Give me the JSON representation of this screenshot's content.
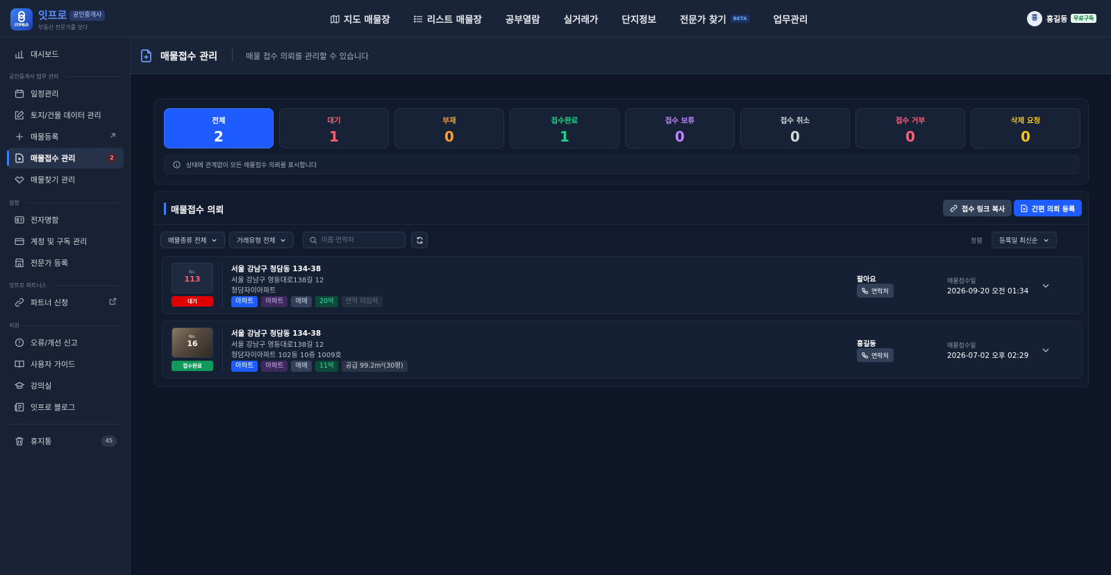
{
  "brand": {
    "name": "잇프로",
    "badge": "공인중개사",
    "tagline": "부동산 전문가를 잇다",
    "logo_text": "ITPRO"
  },
  "nav": [
    {
      "label": "지도 매물장",
      "icon": "map-icon"
    },
    {
      "label": "리스트 매물장",
      "icon": "list-icon"
    },
    {
      "label": "공부열람"
    },
    {
      "label": "실거래가"
    },
    {
      "label": "단지정보"
    },
    {
      "label": "전문가 찾기",
      "badge": "BETA"
    },
    {
      "label": "업무관리"
    }
  ],
  "user": {
    "avatar": "홍",
    "name": "홍길동",
    "plan": "무료구독"
  },
  "sidebar": {
    "dashboard": "대시보드",
    "section_work": "공인중개사 업무 관리",
    "schedule": "일정관리",
    "land_data": "토지/건물 데이터 관리",
    "register": "매물등록",
    "intake": "매물접수 관리",
    "intake_count": "2",
    "find": "매물찾기 관리",
    "section_settings": "설정",
    "ecard": "전자명함",
    "account": "계정 및 구독 관리",
    "expert": "전문가 등록",
    "section_partners": "잇프로 파트너스",
    "partner": "파트너 신청",
    "section_support": "지원",
    "report": "오류/개선 신고",
    "guide": "사용자 가이드",
    "lecture": "강의실",
    "blog": "잇프로 블로그",
    "trash": "휴지통",
    "trash_count": "45"
  },
  "page": {
    "title": "매물접수 관리",
    "description": "매물 접수 의뢰를 관리할 수 있습니다"
  },
  "stats": [
    {
      "label": "전체",
      "value": "2",
      "color": "#ffffff"
    },
    {
      "label": "대기",
      "value": "1",
      "color": "#ff5f6d"
    },
    {
      "label": "부재",
      "value": "0",
      "color": "#ff9f2e"
    },
    {
      "label": "접수완료",
      "value": "1",
      "color": "#19d58a"
    },
    {
      "label": "접수 보류",
      "value": "0",
      "color": "#c084fc"
    },
    {
      "label": "접수 취소",
      "value": "0",
      "color": "#d1d5db"
    },
    {
      "label": "접수 거부",
      "value": "0",
      "color": "#ff5f7e"
    },
    {
      "label": "삭제 요청",
      "value": "0",
      "color": "#f5c518"
    }
  ],
  "stats_note": "상태에 관계없이 모든 매물접수 의뢰를 표시합니다",
  "list": {
    "title": "매물접수 의뢰",
    "copy_link": "접수 링크 복사",
    "quick_register": "간편 의뢰 등록",
    "filter_type": "매물종류 전체",
    "filter_deal": "거래유형 전체",
    "search_placeholder": "이름·연락처",
    "sort_label": "정렬",
    "sort_value": "등록일 최신순"
  },
  "rows": [
    {
      "no_label": "No.",
      "no": "113",
      "no_color": "#ff5f6d",
      "status": "대기",
      "status_color": "#e00000",
      "addr1": "서울 강남구 청담동 134-38",
      "addr2": "서울 강남구 영동대로138길 12",
      "addr3": "청담자이아파트",
      "chips": [
        {
          "text": "아파트",
          "bg": "#1e5cff",
          "fg": "#ffffff"
        },
        {
          "text": "아파트",
          "bg": "#3b2a5a",
          "fg": "#d8b4fe"
        },
        {
          "text": "매매",
          "bg": "#334158",
          "fg": "#d1d5db"
        },
        {
          "text": "20억",
          "bg": "#0d4a3a",
          "fg": "#34e0a1"
        },
        {
          "text": "면적 미입력",
          "bg": "#222d40",
          "fg": "#5e6a7e"
        }
      ],
      "owner": "팔아요",
      "contact": "연락처",
      "date_label": "매물접수일",
      "date": "2026-09-20 오전 01:34"
    },
    {
      "no_label": "No.",
      "no": "16",
      "no_color": "#ffffff",
      "status": "접수완료",
      "status_color": "#0f9a5c",
      "addr1": "서울 강남구 청담동 134-38",
      "addr2": "서울 강남구 영동대로138길 12",
      "addr3": "청담자이아파트 102동 10층 1009호",
      "chips": [
        {
          "text": "아파트",
          "bg": "#1e5cff",
          "fg": "#ffffff"
        },
        {
          "text": "아파트",
          "bg": "#3b2a5a",
          "fg": "#d8b4fe"
        },
        {
          "text": "매매",
          "bg": "#334158",
          "fg": "#d1d5db"
        },
        {
          "text": "11억",
          "bg": "#0d4a3a",
          "fg": "#34e0a1"
        },
        {
          "text": "공급 99.2m²(30평)",
          "bg": "#2a3447",
          "fg": "#d1d5db"
        }
      ],
      "owner": "홍길동",
      "contact": "연락처",
      "date_label": "매물접수일",
      "date": "2026-07-02 오후 02:29"
    }
  ]
}
